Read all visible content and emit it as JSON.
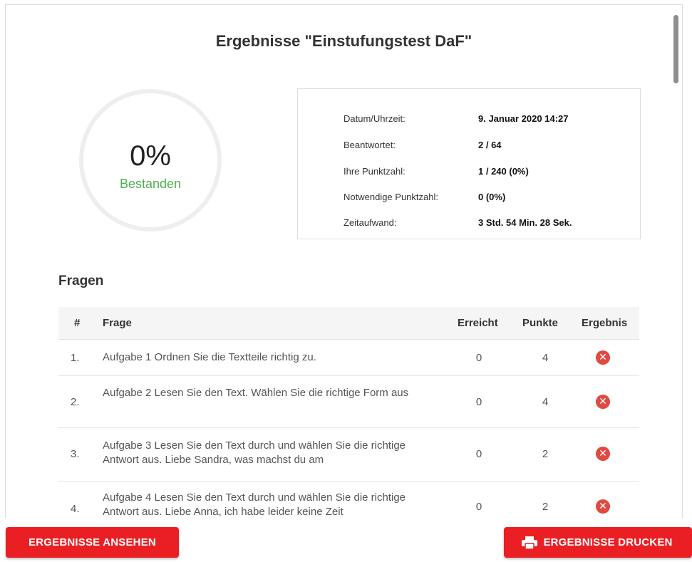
{
  "header": {
    "title": "Ergebnisse \"Einstufungstest DaF\""
  },
  "score": {
    "percent": "0%",
    "status": "Bestanden",
    "status_color": "#4caf50"
  },
  "stats": [
    {
      "label": "Datum/Uhrzeit:",
      "value": "9. Januar 2020 14:27"
    },
    {
      "label": "Beantwortet:",
      "value": "2 / 64"
    },
    {
      "label": "Ihre Punktzahl:",
      "value": "1 / 240 (0%)"
    },
    {
      "label": "Notwendige Punktzahl:",
      "value": "0 (0%)"
    },
    {
      "label": "Zeitaufwand:",
      "value": "3 Std. 54 Min. 28 Sek."
    }
  ],
  "questions": {
    "section_title": "Fragen",
    "columns": {
      "num": "#",
      "question": "Frage",
      "achieved": "Erreicht",
      "points": "Punkte",
      "result": "Ergebnis"
    },
    "rows": [
      {
        "num": "1.",
        "text": "Aufgabe 1 Ordnen Sie die Textteile richtig zu.",
        "achieved": "0",
        "points": "4",
        "result": "wrong"
      },
      {
        "num": "2.",
        "text": "Aufgabe 2 Lesen Sie den Text. Wählen Sie die richtige Form aus",
        "achieved": "0",
        "points": "4",
        "result": "wrong"
      },
      {
        "num": "3.",
        "text": "Aufgabe 3 Lesen Sie den Text durch und wählen Sie die richtige Antwort aus.   Liebe Sandra, was machst du am",
        "achieved": "0",
        "points": "2",
        "result": "wrong"
      },
      {
        "num": "4.",
        "text": "Aufgabe 4 Lesen Sie den Text durch und wählen Sie die richtige Antwort aus.   Liebe Anna, ich habe leider keine Zeit",
        "achieved": "0",
        "points": "2",
        "result": "wrong"
      }
    ]
  },
  "actions": {
    "view_label": "ERGEBNISSE ANSEHEN",
    "print_label": "ERGEBNISSE DRUCKEN",
    "accent": "#ea1f24"
  },
  "icons": {
    "result_wrong": "x-circle-icon",
    "print": "printer-icon"
  }
}
